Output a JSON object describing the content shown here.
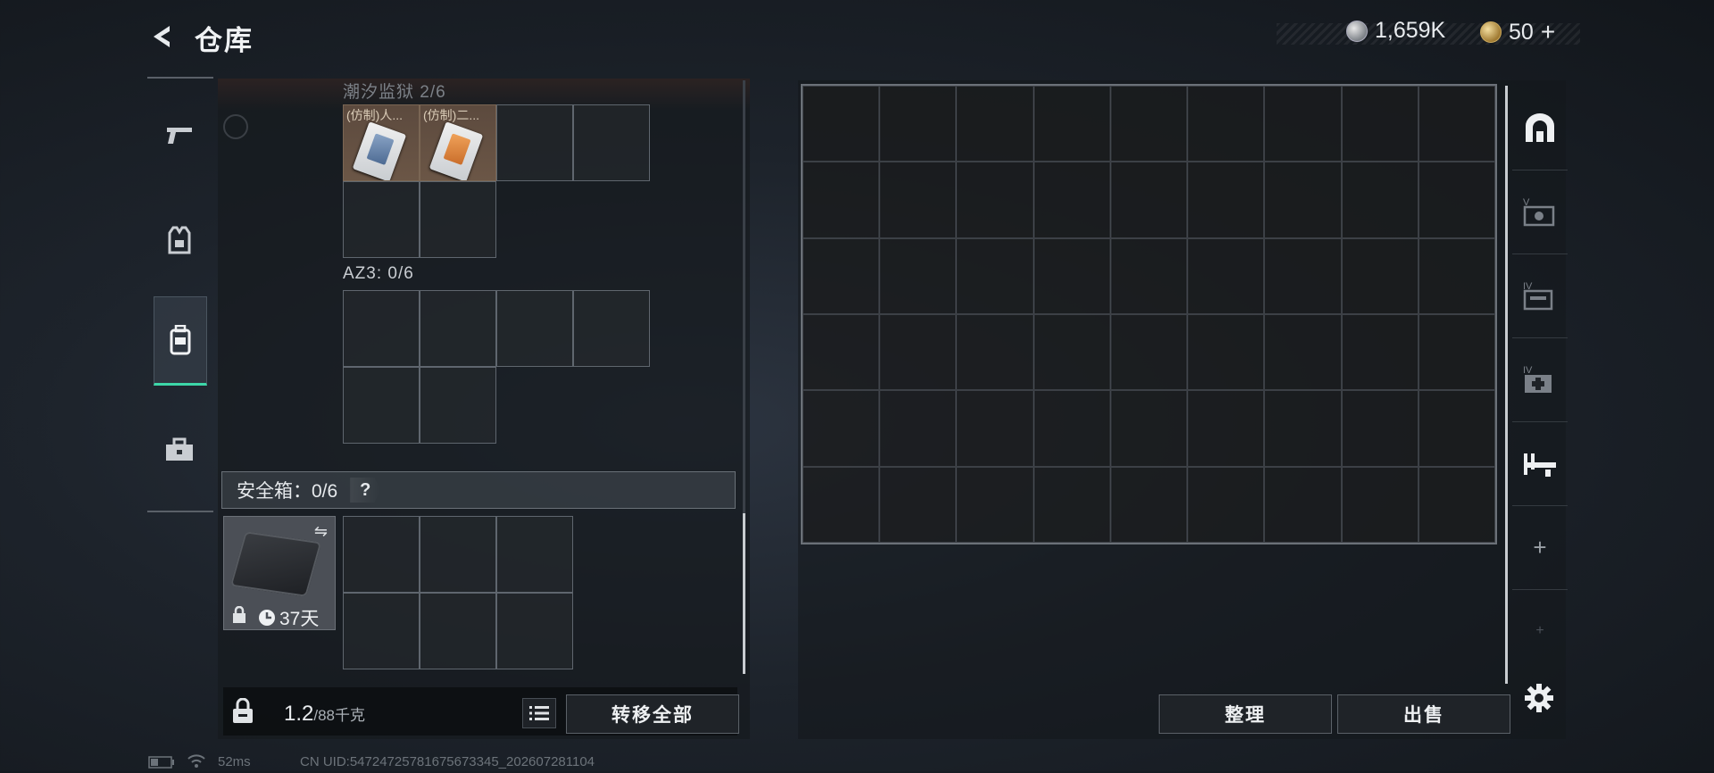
{
  "header": {
    "title": "仓库",
    "currency_silver": "1,659K",
    "currency_gold": "50",
    "currency_plus": "+"
  },
  "backpack": {
    "container1_label": "潮汐监狱 2/6",
    "container1_items": [
      {
        "name": "(仿制)人..."
      },
      {
        "name": "(仿制)二..."
      }
    ],
    "container2_label": "AZ3: 0/6",
    "safe_box_label": "安全箱：0/6",
    "safe_box_help": "?",
    "safe_case_days": "37天",
    "weight_current": "1.2",
    "weight_max": "/88千克",
    "transfer_all_label": "转移全部"
  },
  "storage": {
    "organize_label": "整理",
    "sell_label": "出售",
    "add_label": "+",
    "plus_small": "+"
  },
  "status": {
    "ping": "52ms",
    "uid": "CN UID:5472472578167567334​5_202607281104"
  }
}
